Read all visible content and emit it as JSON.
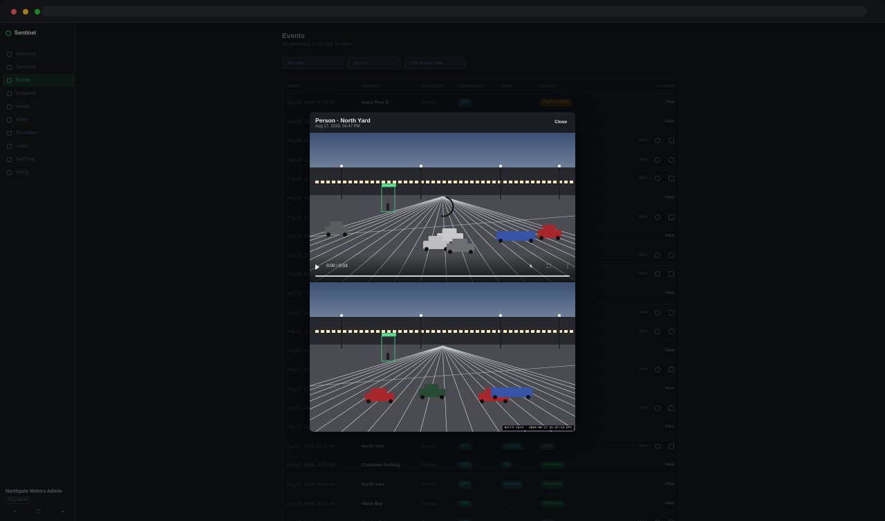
{
  "app": {
    "brand": "Sentinel"
  },
  "sidebar": {
    "items": [
      {
        "label": "Overview"
      },
      {
        "label": "Cameras"
      },
      {
        "label": "Events",
        "active": true
      },
      {
        "label": "Respond"
      },
      {
        "label": "Health"
      },
      {
        "label": "Alerts"
      },
      {
        "label": "Escalation"
      },
      {
        "label": "Users"
      },
      {
        "label": "Audit log"
      },
      {
        "label": "Billing"
      }
    ],
    "org_name": "Northgate Motors Admin",
    "role": "Org admin",
    "footer_icons": [
      "sun-icon",
      "key-icon",
      "logout-icon"
    ]
  },
  "page": {
    "title": "Events",
    "subtitle": "31 detections in the last 24 hours",
    "filters": {
      "site": "All sites",
      "object": "person",
      "review": "Any review state"
    }
  },
  "table": {
    "headers": [
      "WHEN",
      "CAMERA",
      "DETECTED",
      "CONFIDENCE",
      "ZONE",
      "REVIEW",
      "ACTIONS"
    ],
    "rows": [
      {
        "when": "Aug 19, 2026, 05:44 PM",
        "camera": "Sales Row B",
        "detected": "Person",
        "conf": "53%",
        "zone": "—",
        "review": "False positive",
        "rtype": "false",
        "extra": false
      },
      {
        "when": "Aug 19, 2026",
        "camera": "",
        "detected": "",
        "conf": "",
        "zone": "",
        "review": "",
        "rtype": "",
        "extra": false
      },
      {
        "when": "Aug 18, 2026",
        "camera": "",
        "detected": "",
        "conf": "",
        "zone": "",
        "review": "",
        "rtype": "",
        "extra": true
      },
      {
        "when": "Aug 18, 2026",
        "camera": "",
        "detected": "",
        "conf": "",
        "zone": "",
        "review": "",
        "rtype": "",
        "extra": true
      },
      {
        "when": "Aug 18, 2026",
        "camera": "",
        "detected": "",
        "conf": "",
        "zone": "",
        "review": "",
        "rtype": "",
        "extra": true
      },
      {
        "when": "Aug 18, 2026",
        "camera": "",
        "detected": "",
        "conf": "",
        "zone": "",
        "review": "",
        "rtype": "",
        "extra": false
      },
      {
        "when": "Aug 18, 2026",
        "camera": "",
        "detected": "",
        "conf": "",
        "zone": "",
        "review": "",
        "rtype": "",
        "extra": true
      },
      {
        "when": "Aug 18, 2026",
        "camera": "",
        "detected": "",
        "conf": "",
        "zone": "",
        "review": "",
        "rtype": "",
        "extra": false
      },
      {
        "when": "Aug 18, 2026",
        "camera": "",
        "detected": "",
        "conf": "",
        "zone": "",
        "review": "",
        "rtype": "",
        "extra": true
      },
      {
        "when": "Aug 18, 2026",
        "camera": "",
        "detected": "",
        "conf": "",
        "zone": "",
        "review": "",
        "rtype": "",
        "extra": true
      },
      {
        "when": "Aug 18, 2026",
        "camera": "",
        "detected": "",
        "conf": "",
        "zone": "",
        "review": "",
        "rtype": "",
        "extra": false
      },
      {
        "when": "Aug 17, 2026",
        "camera": "",
        "detected": "",
        "conf": "",
        "zone": "",
        "review": "",
        "rtype": "",
        "extra": true
      },
      {
        "when": "Aug 17, 2026",
        "camera": "",
        "detected": "",
        "conf": "",
        "zone": "",
        "review": "",
        "rtype": "",
        "extra": true
      },
      {
        "when": "Aug 17, 2026",
        "camera": "",
        "detected": "",
        "conf": "",
        "zone": "",
        "review": "",
        "rtype": "",
        "extra": false
      },
      {
        "when": "Aug 17, 2026",
        "camera": "",
        "detected": "",
        "conf": "",
        "zone": "",
        "review": "",
        "rtype": "",
        "extra": true
      },
      {
        "when": "Aug 17, 2026",
        "camera": "",
        "detected": "",
        "conf": "",
        "zone": "",
        "review": "",
        "rtype": "",
        "extra": false
      },
      {
        "when": "Aug 17, 2026",
        "camera": "",
        "detected": "",
        "conf": "",
        "zone": "",
        "review": "",
        "rtype": "",
        "extra": true
      },
      {
        "when": "Aug 17, 2026",
        "camera": "",
        "detected": "",
        "conf": "",
        "zone": "",
        "review": "",
        "rtype": "",
        "extra": false
      },
      {
        "when": "Aug 17, 2026, 12:15 PM",
        "camera": "North Yard",
        "detected": "Person",
        "conf": "80%",
        "zone": "property",
        "review": "New",
        "rtype": "new",
        "extra": true
      },
      {
        "when": "Aug 17, 2026, 10:15 AM",
        "camera": "Customer Parking",
        "detected": "Person",
        "conf": "72%",
        "zone": "lot",
        "review": "Reviewed",
        "rtype": "rev",
        "extra": false
      },
      {
        "when": "Aug 17, 2026, 09:04 AM",
        "camera": "North Yard",
        "detected": "Person",
        "conf": "59%",
        "zone": "property",
        "review": "Reviewed",
        "rtype": "rev",
        "extra": false
      },
      {
        "when": "Aug 17, 2026, 08:52 AM",
        "camera": "Wash Bay",
        "detected": "Person",
        "conf": "59%",
        "zone": "—",
        "review": "Reviewed",
        "rtype": "rev",
        "extra": false
      },
      {
        "when": "Aug 17, 2026, 08:14 AM",
        "camera": "Service Drive",
        "detected": "Person",
        "conf": "64%",
        "zone": "—",
        "review": "New",
        "rtype": "new",
        "extra": true
      }
    ],
    "view_label": "View"
  },
  "modal": {
    "title": "Person · North Yard",
    "subtitle": "Aug 17, 2026, 04:47 PM",
    "close_label": "Close",
    "video": {
      "time": "0:00 / 0:03",
      "progress": 0,
      "detection_label": "person 81%"
    },
    "snapshot": {
      "detection_label": "person 81%",
      "timestamp": "North Yard · 2026-08-17 21:47:13 UTC"
    }
  }
}
